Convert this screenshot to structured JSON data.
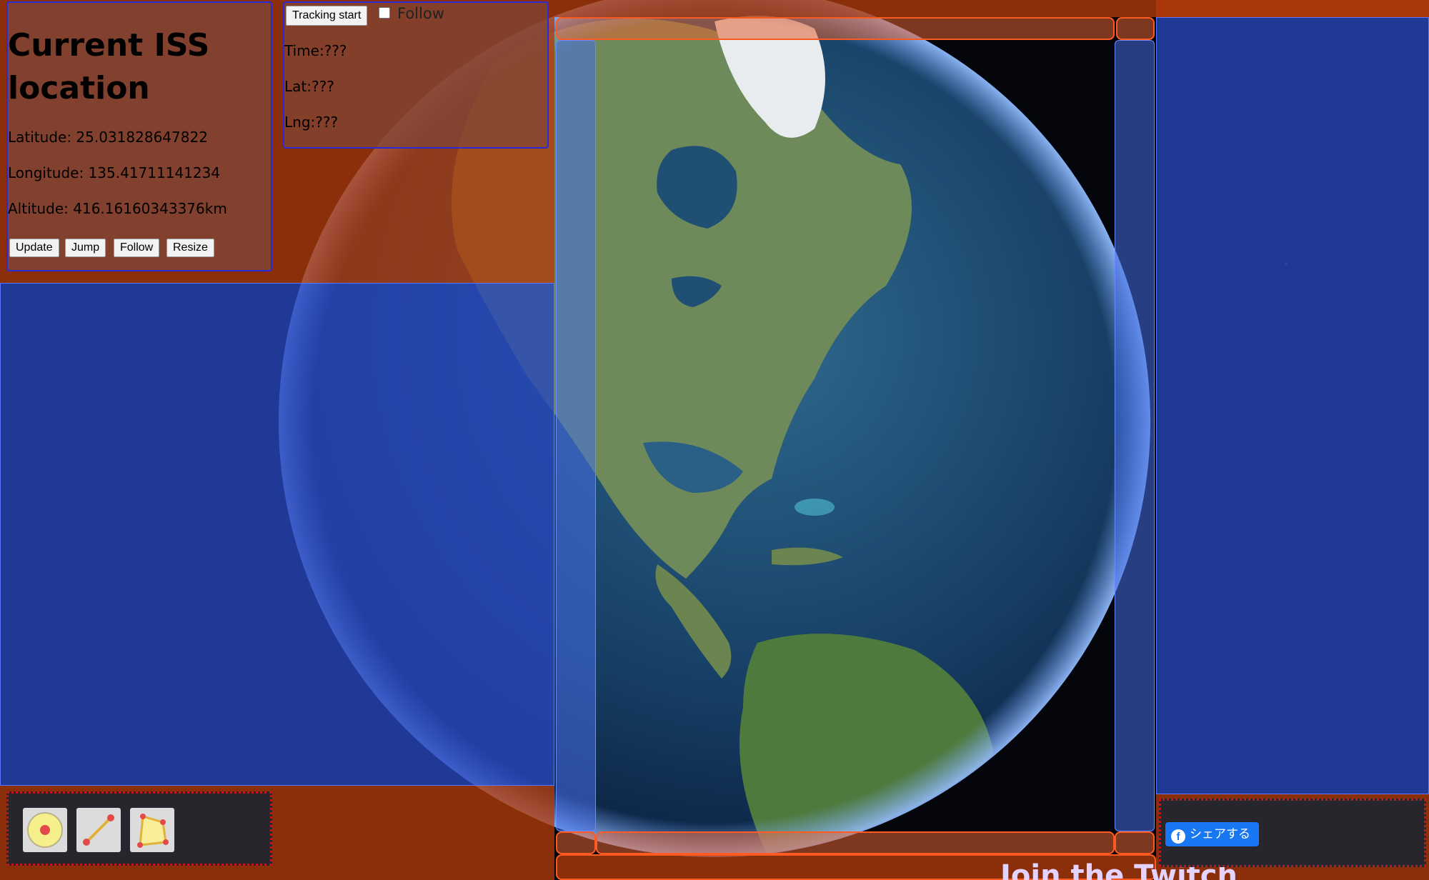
{
  "info": {
    "title": "Current ISS location",
    "latitude": "Latitude: 25.031828647822",
    "longitude": "Longitude: 135.41711141234",
    "altitude": "Altitude: 416.16160343376km",
    "buttons": [
      "Update",
      "Jump",
      "Follow",
      "Resize"
    ]
  },
  "tracking": {
    "start_button": "Tracking start",
    "follow_label": "Follow",
    "follow_checked": false,
    "time": "Time:???",
    "lat": "Lat:???",
    "lng": "Lng:???"
  },
  "toolbar": {
    "tools": [
      "circle-marker-icon",
      "line-tool-icon",
      "polygon-tool-icon"
    ]
  },
  "share": {
    "label": "シェアする",
    "icon": "facebook-icon"
  },
  "footer": {
    "partial_text": "Join the Twitch community!"
  },
  "colors": {
    "overlay_orange": "#b13a0a",
    "overlay_blue": "#2846be",
    "panel_border": "#2a2ad6",
    "share_blue": "#1877f2",
    "dotted_border": "#c01818"
  }
}
